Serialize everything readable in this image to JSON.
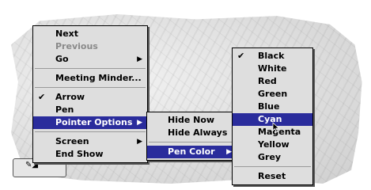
{
  "main_menu": {
    "items": [
      {
        "label": "Next"
      },
      {
        "label": "Previous"
      },
      {
        "label": "Go"
      },
      {
        "label": "Meeting Minder..."
      },
      {
        "label": "Arrow"
      },
      {
        "label": "Pen"
      },
      {
        "label": "Pointer Options"
      },
      {
        "label": "Screen"
      },
      {
        "label": "End Show"
      }
    ]
  },
  "pointer_submenu": {
    "items": [
      {
        "label": "Hide Now"
      },
      {
        "label": "Hide Always"
      },
      {
        "label": "Pen Color"
      }
    ]
  },
  "color_submenu": {
    "items": [
      {
        "label": "Black"
      },
      {
        "label": "White"
      },
      {
        "label": "Red"
      },
      {
        "label": "Green"
      },
      {
        "label": "Blue"
      },
      {
        "label": "Cyan"
      },
      {
        "label": "Magenta"
      },
      {
        "label": "Yellow"
      },
      {
        "label": "Grey"
      },
      {
        "label": "Reset"
      }
    ]
  },
  "colors": {
    "highlight": "#2a2c9c",
    "menu_bg": "#dedede",
    "disabled_text": "#8a8a8a"
  },
  "icons": [
    "checkmark-icon",
    "submenu-arrow-icon",
    "pointer-cursor-icon"
  ]
}
